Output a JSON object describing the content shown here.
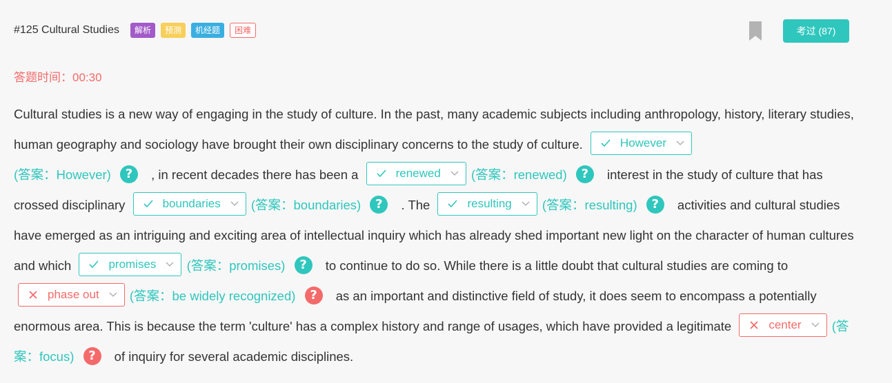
{
  "header": {
    "question_title": "#125 Cultural Studies",
    "tags": [
      "解析",
      "预测",
      "机经题",
      "困难"
    ],
    "done_button": "考过 (87)"
  },
  "timer": {
    "label": "答题时间：",
    "value": "00:30"
  },
  "passage": {
    "seg0": "Cultural studies is a new way of engaging in the study of culture. In the past, many academic subjects including anthropology, history, literary studies, human geography and sociology have brought their own disciplinary concerns to the study of culture.",
    "seg1": ", in recent decades there has been a",
    "seg2": "interest in the study of culture that has crossed disciplinary",
    "seg3": ". The",
    "seg4": "activities and cultural studies have emerged as an intriguing and exciting area of intellectual inquiry which has already shed important new light on the character of human cultures and which",
    "seg5": "to continue to do so. While there is a little doubt that cultural studies are coming to",
    "seg6": "as an important and distinctive field of study, it does seem to encompass a potentially enormous area. This is because the term 'culture' has a complex history and range of usages, which have provided a legitimate",
    "seg7": "of inquiry for several academic disciplines."
  },
  "blanks": [
    {
      "selected": "However",
      "answer": "(答案：However)",
      "status": "correct"
    },
    {
      "selected": "renewed",
      "answer": "(答案：renewed)",
      "status": "correct"
    },
    {
      "selected": "boundaries",
      "answer": "(答案：boundaries)",
      "status": "correct"
    },
    {
      "selected": "resulting",
      "answer": "(答案：resulting)",
      "status": "correct"
    },
    {
      "selected": "promises",
      "answer": "(答案：promises)",
      "status": "correct"
    },
    {
      "selected": "phase out",
      "answer": "(答案：be widely recognized)",
      "status": "wrong"
    },
    {
      "selected": "center",
      "answer": "(答案：focus)",
      "status": "wrong"
    }
  ],
  "help_glyph": "?",
  "colors": {
    "accent": "#2fc6bd",
    "error": "#f46a6a",
    "bookmark": "#b3b3b3"
  },
  "icons": {
    "correct": "check-icon",
    "wrong": "cross-icon",
    "dropdown": "chevron-down-icon",
    "bookmark": "bookmark-icon",
    "help": "question-circle-icon"
  }
}
